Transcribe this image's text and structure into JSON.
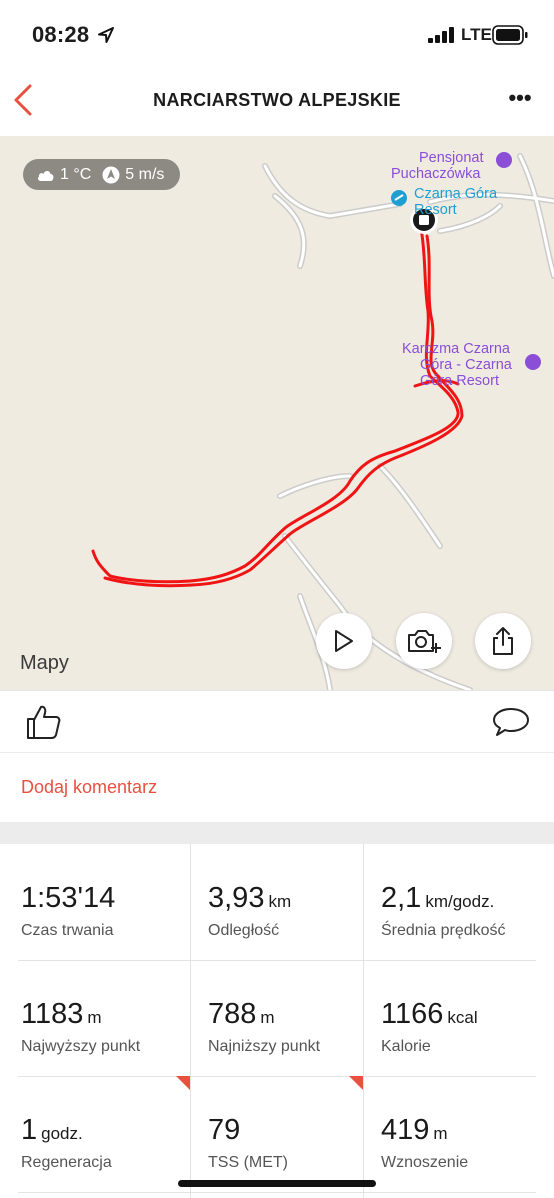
{
  "status_bar": {
    "time": "08:28",
    "network": "LTE"
  },
  "header": {
    "title": "NARCIARSTWO ALPEJSKIE"
  },
  "map": {
    "weather": {
      "temperature": "1 °C",
      "wind": "5 m/s"
    },
    "pois": {
      "pensjonat": "Pensjonat Puchaczówka",
      "czarna_gora": "Czarna Góra Resort",
      "karczma": "Karczma Czarna Góra - Czarna Góra Resort"
    },
    "pois_lines": {
      "pensjonat_1": "Pensjonat",
      "pensjonat_2": "Puchaczówka",
      "czarna_1": "Czarna Góra",
      "czarna_2": "Resort",
      "karczma_1": "Karczma Czarna",
      "karczma_2": "Góra - Czarna",
      "karczma_3": "Góra Resort"
    },
    "attribution": "Mapy",
    "route_color": "#f01414"
  },
  "actions": {
    "add_comment": "Dodaj komentarz"
  },
  "stats": [
    {
      "value": "1:53'14",
      "unit": "",
      "label": "Czas trwania"
    },
    {
      "value": "3,93",
      "unit": "km",
      "label": "Odległość"
    },
    {
      "value": "2,1",
      "unit": "km/godz.",
      "label": "Średnia prędkość"
    },
    {
      "value": "1183",
      "unit": "m",
      "label": "Najwyższy punkt"
    },
    {
      "value": "788",
      "unit": "m",
      "label": "Najniższy punkt"
    },
    {
      "value": "1166",
      "unit": "kcal",
      "label": "Kalorie"
    },
    {
      "value": "1",
      "unit": "godz.",
      "label": "Regeneracja"
    },
    {
      "value": "79",
      "unit": "",
      "label": "TSS (MET)"
    },
    {
      "value": "419",
      "unit": "m",
      "label": "Wznoszenie"
    }
  ],
  "colors": {
    "accent": "#e8503f",
    "map_bg": "#efebe1"
  }
}
